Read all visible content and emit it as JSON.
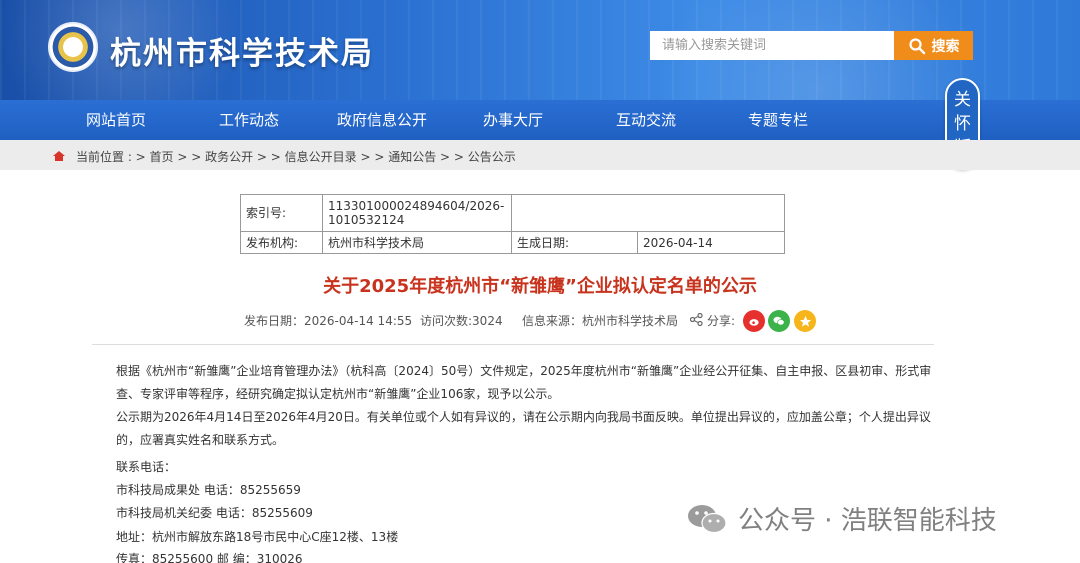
{
  "header": {
    "site_title": "杭州市科学技术局",
    "search_placeholder": "请输入搜索关键词",
    "search_button": "搜索",
    "colors": {
      "banner": "#2a6fd0",
      "nav": "#1f5fc2",
      "search_button": "#f08c1a",
      "title_red": "#c8331e"
    }
  },
  "nav": {
    "items": [
      "网站首页",
      "工作动态",
      "政府信息公开",
      "办事大厅",
      "互动交流",
      "专题专栏"
    ]
  },
  "care_button": [
    "关",
    "怀",
    "版"
  ],
  "breadcrumb": {
    "text": "当前位置 : > 首页 > > 政务公开 > > 信息公开目录 > > 通知公告 > > 公告公示"
  },
  "info_table": {
    "index_label": "索引号:",
    "index_value": "113301000024894604/2026-1010532124",
    "publisher_label": "发布机构:",
    "publisher_value": "杭州市科学技术局",
    "date_label": "生成日期:",
    "date_value": "2026-04-14"
  },
  "article": {
    "title": "关于2025年度杭州市“新雏鹰”企业拟认定名单的公示",
    "publish_date": "发布日期：2026-04-14 14:55",
    "visits": "访问次数:3024",
    "source": "信息来源：杭州市科学技术局",
    "share_label": "分享:",
    "para1": "根据《杭州市“新雏鹰”企业培育管理办法》（杭科高〔2024〕50号）文件规定，2025年度杭州市“新雏鹰”企业经公开征集、自主申报、区县初审、形式审查、专家评审等程序，经研究确定拟认定杭州市“新雏鹰”企业106家，现予以公示。",
    "para2": "公示期为2026年4月14日至2026年4月20日。有关单位或个人如有异议的，请在公示期内向我局书面反映。单位提出异议的，应加盖公章；个人提出异议的，应署真实姓名和联系方式。",
    "contact_title": "联系电话：",
    "contact1": "市科技局成果处 电话：85255659",
    "contact2": "市科技局机关纪委 电话：85255609",
    "address": "地址：杭州市解放东路18号市民中心C座12楼、13楼",
    "fax": "传真：85255600 邮 编：310026"
  },
  "watermark": {
    "text": "公众号 · 浩联智能科技"
  }
}
